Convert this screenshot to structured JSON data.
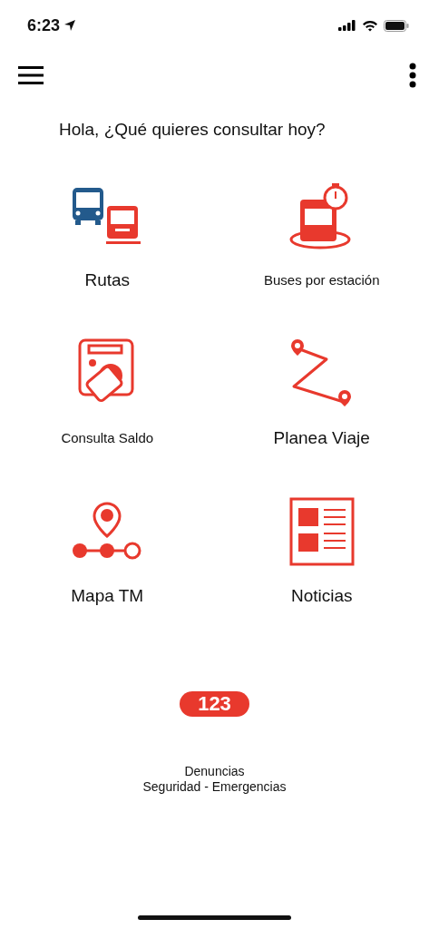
{
  "status_bar": {
    "time": "6:23"
  },
  "greeting": "Hola, ¿Qué quieres consultar hoy?",
  "tiles": [
    {
      "kind": "routes",
      "label": "Rutas"
    },
    {
      "kind": "station",
      "label": "Buses por estación"
    },
    {
      "kind": "balance",
      "label": "Consulta Saldo"
    },
    {
      "kind": "trip",
      "label": "Planea Viaje"
    },
    {
      "kind": "map",
      "label": "Mapa TM"
    },
    {
      "kind": "news",
      "label": "Noticias"
    }
  ],
  "emergency": {
    "number": "123",
    "lines": [
      "Denuncias",
      "Seguridad - Emergencias"
    ]
  }
}
